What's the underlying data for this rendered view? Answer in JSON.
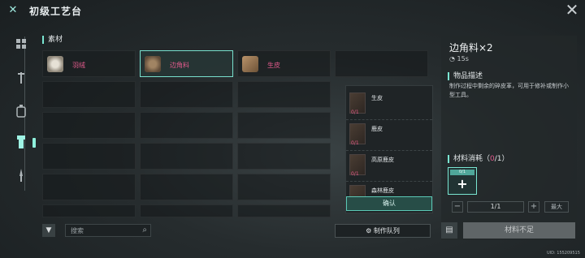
{
  "header": {
    "title": "初级工艺台",
    "logo_icon": "crossed-tools-icon",
    "close_icon": "close-icon"
  },
  "sidebar": {
    "items": [
      {
        "icon": "grid-icon",
        "active": false
      },
      {
        "icon": "wrench-icon",
        "active": false
      },
      {
        "icon": "canister-icon",
        "active": false
      },
      {
        "icon": "flashlight-icon",
        "active": true
      },
      {
        "icon": "knife-icon",
        "active": false
      }
    ]
  },
  "materials": {
    "section_label": "素材",
    "items": [
      {
        "name": "羽绒",
        "selected": false
      },
      {
        "name": "边角料",
        "selected": true
      },
      {
        "name": "生皮",
        "selected": false
      }
    ]
  },
  "dropdown": {
    "items": [
      {
        "name": "生皮",
        "count": "0/1"
      },
      {
        "name": "鹿皮",
        "count": "0/1"
      },
      {
        "name": "高原鹿皮",
        "count": "0/1"
      },
      {
        "name": "森林鹿皮",
        "count": ""
      }
    ],
    "confirm_label": "确认"
  },
  "bottom": {
    "search_placeholder": "搜索",
    "queue_label": "制作队列"
  },
  "detail": {
    "title": "边角料×2",
    "time": "15s",
    "desc_label": "物品描述",
    "desc_text": "制作过程中剩余的碎皮革，可用于修补或制作小型工具。",
    "cost_label_prefix": "材料消耗（",
    "cost_count": "0",
    "cost_label_suffix": "/1）",
    "slot_tag": "0/1",
    "quantity": "1/1",
    "max_label": "最大",
    "make_label": "材料不足"
  },
  "uid": "UID: 155209515",
  "colors": {
    "accent": "#7ae6d2",
    "count": "#e25a8c"
  }
}
